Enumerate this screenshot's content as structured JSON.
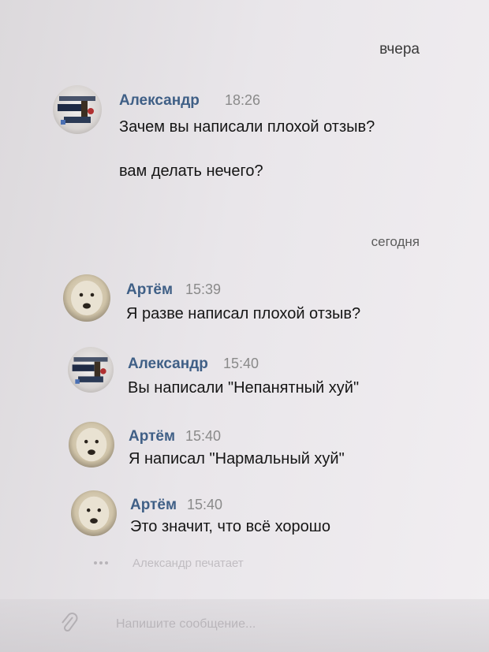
{
  "dates": {
    "yesterday": "вчера",
    "today": "сегодня"
  },
  "messages": [
    {
      "author": "Александр",
      "time": "18:26",
      "lines": [
        "Зачем вы написали плохой отзыв?",
        "вам делать нечего?"
      ],
      "avatar": "game-avatar-icon"
    },
    {
      "author": "Артём",
      "time": "15:39",
      "lines": [
        "Я разве написал плохой отзыв?"
      ],
      "avatar": "dog-avatar-icon"
    },
    {
      "author": "Александр",
      "time": "15:40",
      "lines": [
        "Вы написали \"Непанятный хуй\""
      ],
      "avatar": "game-avatar-icon"
    },
    {
      "author": "Артём",
      "time": "15:40",
      "lines": [
        "Я написал \"Нармальный хуй\""
      ],
      "avatar": "dog-avatar-icon"
    },
    {
      "author": "Артём",
      "time": "15:40",
      "lines": [
        "Это значит, что всё хорошо"
      ],
      "avatar": "dog-avatar-icon"
    }
  ],
  "typing": {
    "text": "Александр печатает"
  },
  "composer": {
    "placeholder": "Напишите сообщение..."
  },
  "colors": {
    "author": "#3f5f86",
    "time": "#8a8a8a",
    "text": "#151515"
  }
}
